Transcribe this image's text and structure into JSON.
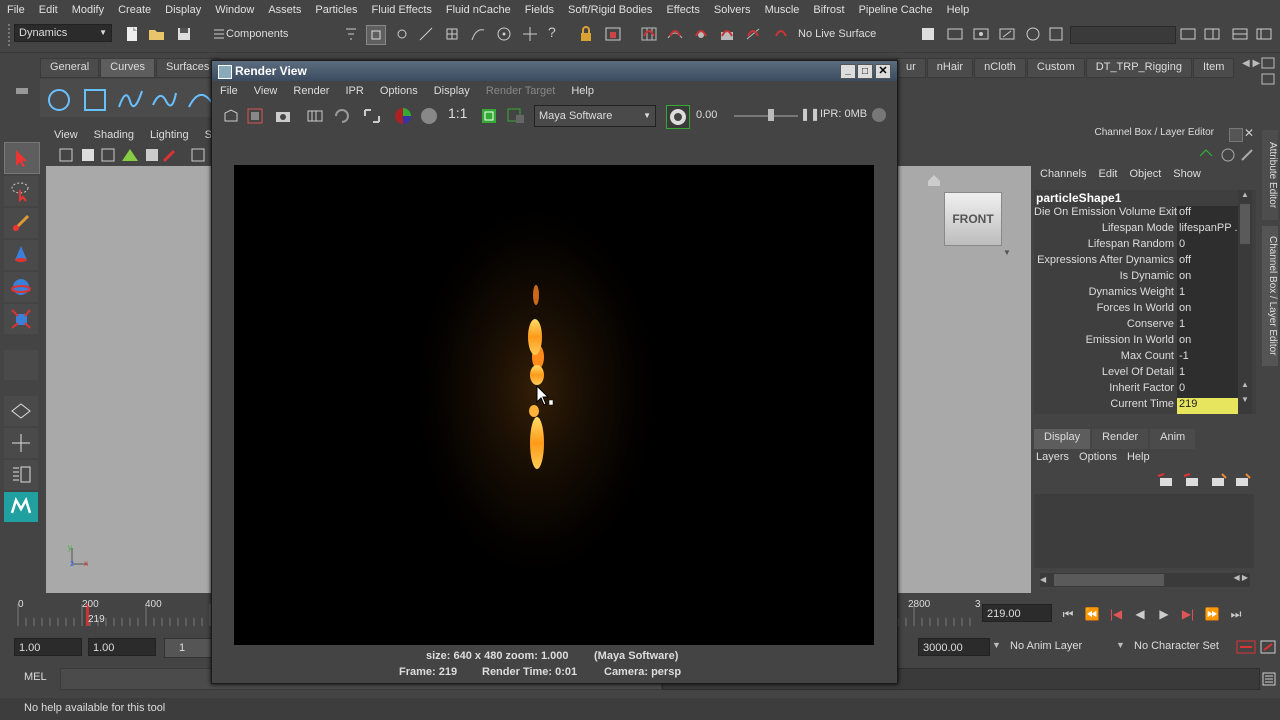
{
  "menubar": [
    "File",
    "Edit",
    "Modify",
    "Create",
    "Display",
    "Window",
    "Assets",
    "Particles",
    "Fluid Effects",
    "Fluid nCache",
    "Fields",
    "Soft/Rigid Bodies",
    "Effects",
    "Solvers",
    "Muscle",
    "Bifrost",
    "Pipeline Cache",
    "Help"
  ],
  "toolbar": {
    "menuset": "Dynamics",
    "selection_mode": "Components",
    "live_surface": "No Live Surface"
  },
  "shelf_tabs_left": [
    "General",
    "Curves",
    "Surfaces"
  ],
  "shelf_tabs_right": [
    "ur",
    "nHair",
    "nCloth",
    "Custom",
    "DT_TRP_Rigging",
    "Item"
  ],
  "viewport_menu": [
    "View",
    "Shading",
    "Lighting",
    "Sho"
  ],
  "viewcube_label": "FRONT",
  "render_view": {
    "title": "Render View",
    "menu": [
      "File",
      "View",
      "Render",
      "IPR",
      "Options",
      "Display",
      "Render Target",
      "Help"
    ],
    "ratio": "1:1",
    "renderer": "Maya Software",
    "exposure": "0.00",
    "ipr": "IPR: 0MB",
    "status_line1": "size: 640 x 480 zoom: 1.000",
    "status_renderer": "(Maya Software)",
    "frame": "Frame: 219",
    "render_time": "Render Time: 0:01",
    "camera": "Camera: persp"
  },
  "channel_box": {
    "title": "Channel Box / Layer Editor",
    "menu": [
      "Channels",
      "Edit",
      "Object",
      "Show"
    ],
    "node": "particleShape1",
    "attributes": [
      {
        "name": "Die On Emission Volume Exit",
        "value": "off"
      },
      {
        "name": "Lifespan Mode",
        "value": "lifespanPP ..."
      },
      {
        "name": "Lifespan Random",
        "value": "0"
      },
      {
        "name": "Expressions After Dynamics",
        "value": "off"
      },
      {
        "name": "Is Dynamic",
        "value": "on"
      },
      {
        "name": "Dynamics Weight",
        "value": "1"
      },
      {
        "name": "Forces In World",
        "value": "on"
      },
      {
        "name": "Conserve",
        "value": "1"
      },
      {
        "name": "Emission In World",
        "value": "on"
      },
      {
        "name": "Max Count",
        "value": "-1"
      },
      {
        "name": "Level Of Detail",
        "value": "1"
      },
      {
        "name": "Inherit Factor",
        "value": "0"
      },
      {
        "name": "Current Time",
        "value": "219"
      }
    ]
  },
  "layer_editor": {
    "tabs": [
      "Display",
      "Render",
      "Anim"
    ],
    "menu": [
      "Layers",
      "Options",
      "Help"
    ]
  },
  "side_tabs": [
    "Attribute Editor",
    "Channel Box / Layer Editor"
  ],
  "timeline": {
    "ticks_left": [
      "0",
      "200",
      "400"
    ],
    "ticks_right": [
      "2800",
      "3"
    ],
    "current_marker": "219",
    "current_time": "219.00"
  },
  "range": {
    "start": "1.00",
    "anim_start": "1.00",
    "range_start": "1",
    "end": "3000.00",
    "anim_layer": "No Anim Layer",
    "character_set": "No Character Set"
  },
  "mel": {
    "label": "MEL"
  },
  "help_line": "No help available for this tool",
  "colors": {
    "accent": "#6a7f96",
    "highlight": "#e7e45d",
    "bg": "#444444",
    "viewport": "#a9a9a9"
  }
}
